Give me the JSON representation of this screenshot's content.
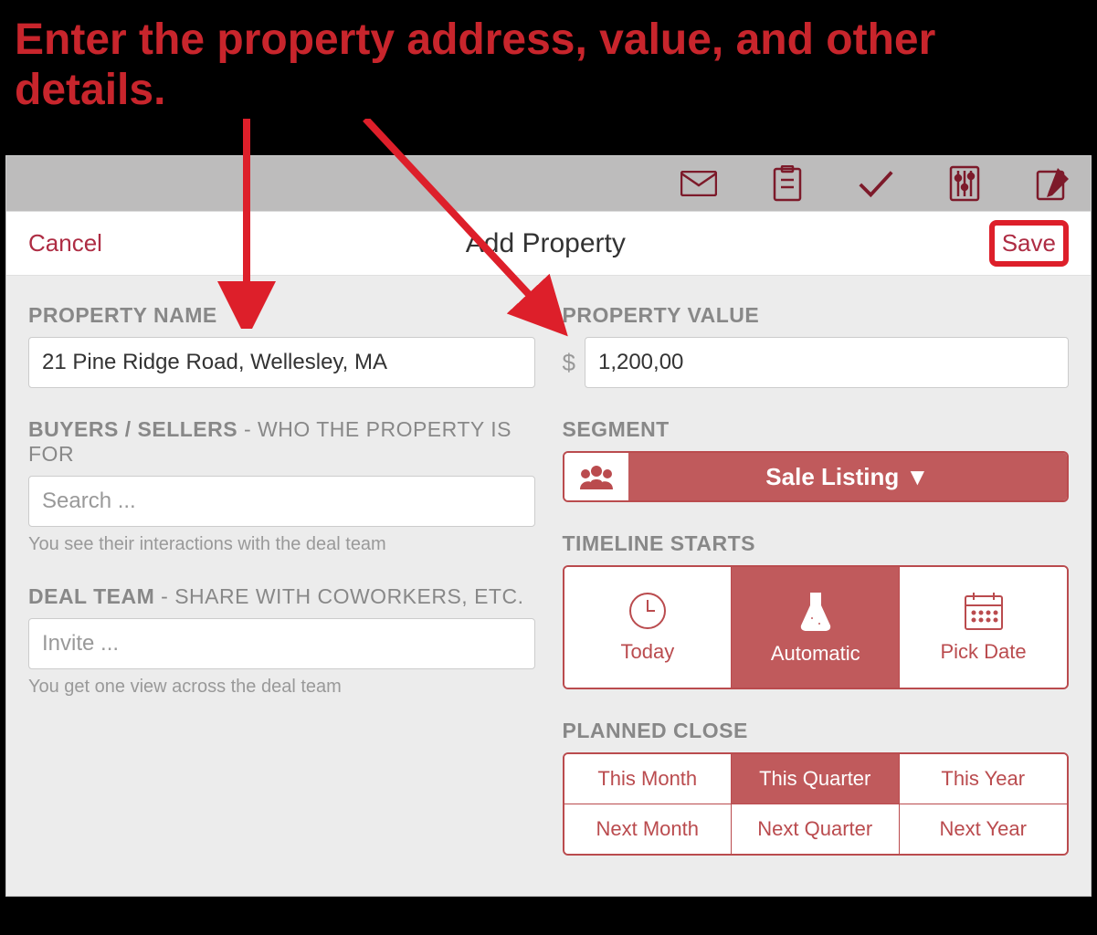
{
  "annotation": "Enter the property address, value, and other details.",
  "modal": {
    "cancel": "Cancel",
    "title": "Add Property",
    "save": "Save"
  },
  "left": {
    "property_name_label": "Property Name",
    "property_name_value": "21 Pine Ridge Road, Wellesley, MA",
    "buyers_label": "Buyers / Sellers",
    "buyers_sub": " - who the property is for",
    "buyers_placeholder": "Search ...",
    "buyers_helper": "You see their interactions with the deal team",
    "dealteam_label": "Deal Team",
    "dealteam_sub": " - share with coworkers, etc.",
    "dealteam_placeholder": "Invite ...",
    "dealteam_helper": "You get one view across the deal team"
  },
  "right": {
    "value_label": "Property Value",
    "value_currency": "$",
    "value_amount": "1,200,00",
    "segment_label": "Segment",
    "segment_value": "Sale Listing ▼",
    "timeline_label": "Timeline Starts",
    "timeline_today": "Today",
    "timeline_auto": "Automatic",
    "timeline_pick": "Pick Date",
    "close_label": "Planned Close",
    "close_opts": [
      "This Month",
      "This Quarter",
      "This Year",
      "Next Month",
      "Next Quarter",
      "Next Year"
    ]
  }
}
